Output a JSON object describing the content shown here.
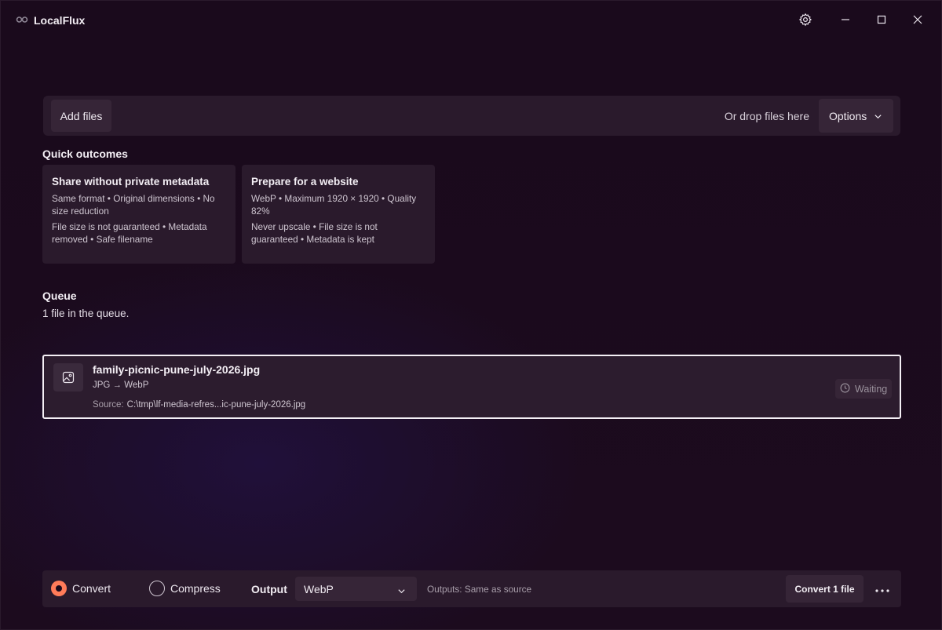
{
  "app": {
    "title": "LocalFlux"
  },
  "icons": {
    "logo": "infinity-logo-icon",
    "settings": "gear-icon",
    "minimize": "minimize-icon",
    "maximize": "maximize-icon",
    "close": "close-icon",
    "dropdown": "chevron-down-icon",
    "file": "image-file-icon",
    "status": "clock-icon",
    "more": "ellipsis-icon"
  },
  "toolbar": {
    "add_files_label": "Add files",
    "drop_hint": "Or drop files here",
    "options_label": "Options"
  },
  "quick_outcomes": {
    "title": "Quick outcomes",
    "cards": [
      {
        "title": "Share without private metadata",
        "line1": "Same format • Original dimensions • No size reduction",
        "line2": "File size is not guaranteed • Metadata removed • Safe filename"
      },
      {
        "title": "Prepare for a website",
        "line1": "WebP • Maximum 1920 × 1920 • Quality 82%",
        "line2": "Never upscale • File size is not guaranteed • Metadata is kept"
      }
    ]
  },
  "queue": {
    "title": "Queue",
    "count_text": "1 file in the queue.",
    "items": [
      {
        "file_name": "family-picnic-pune-july-2026.jpg",
        "conversion": "JPG → WebP",
        "source_label": "Source:",
        "source_path": "C:\\tmp\\lf-media-refres...ic-pune-july-2026.jpg",
        "status": "Waiting"
      }
    ]
  },
  "bottom_bar": {
    "mode_convert_label": "Convert",
    "mode_compress_label": "Compress",
    "selected_mode": "Convert",
    "output_label": "Output",
    "output_format": "WebP",
    "outputs_hint": "Outputs: Same as source",
    "convert_button_label": "Convert 1 file"
  },
  "colors": {
    "background": "#1b0a1d",
    "panel": "#2a1a2c",
    "button": "#362537",
    "accent": "#ff7b59",
    "focus_border": "#f4eff5"
  }
}
